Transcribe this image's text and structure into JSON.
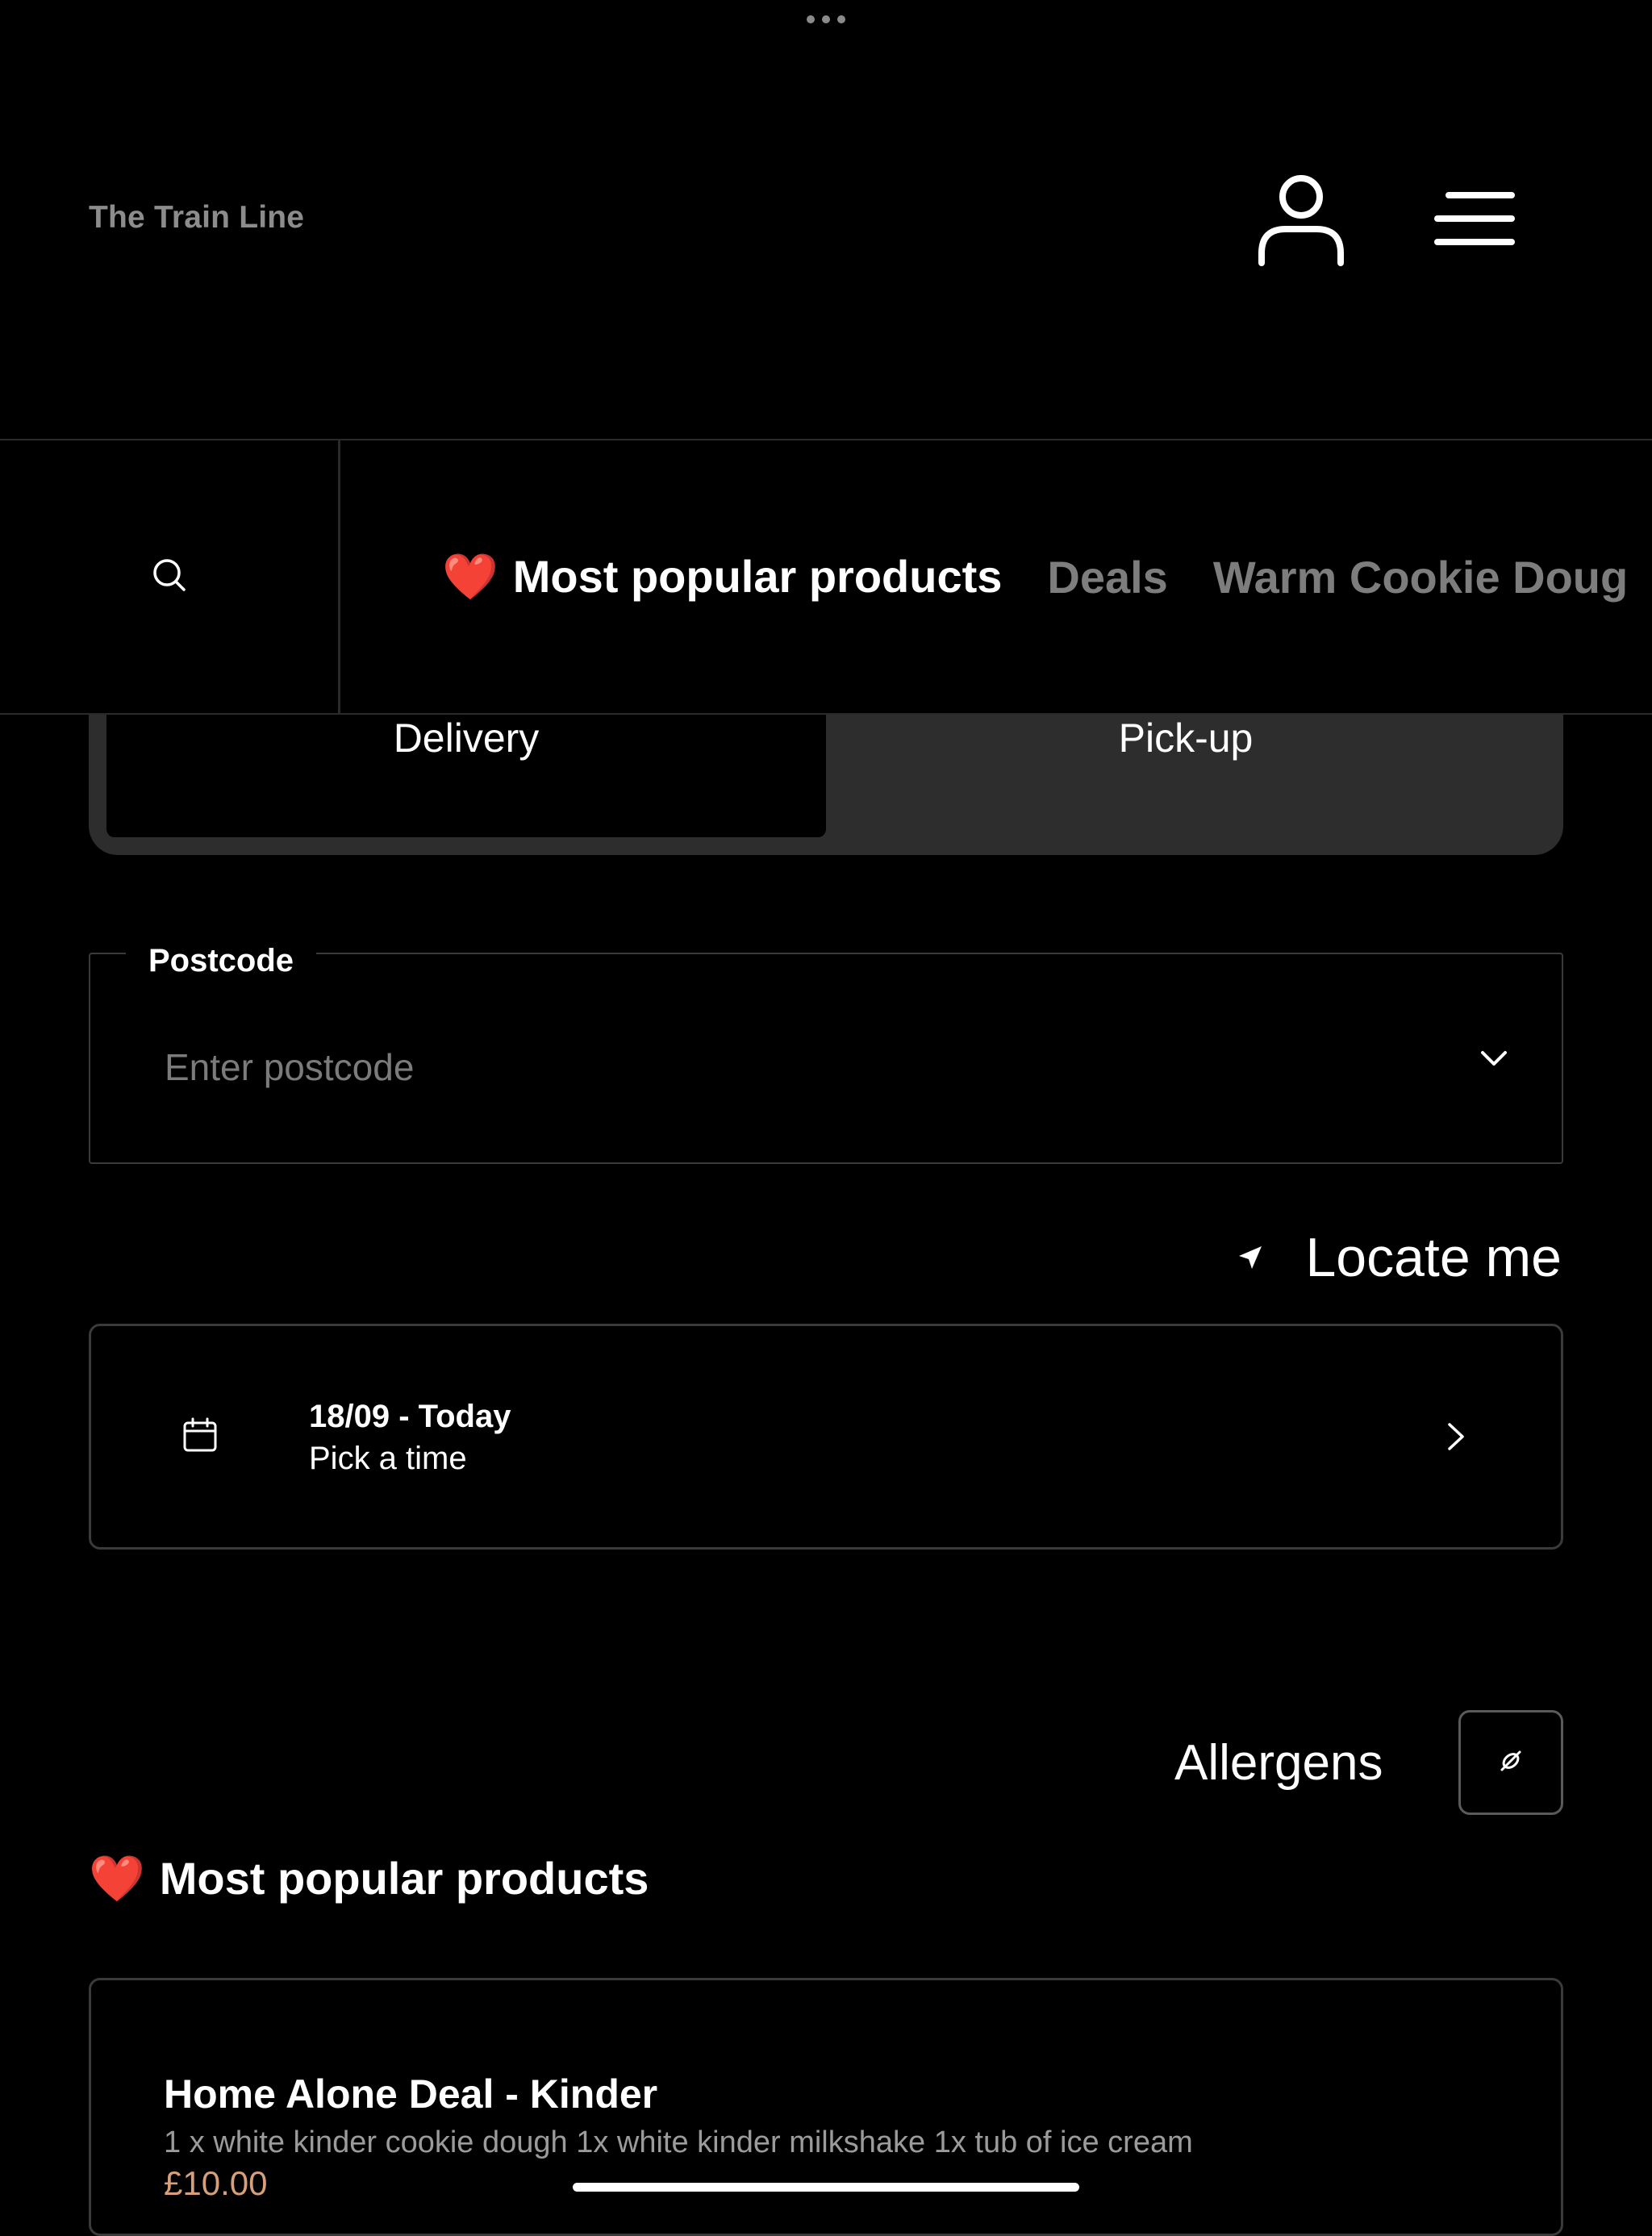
{
  "header": {
    "brand": "The Train Line",
    "icons": {
      "account": "user-icon",
      "menu": "hamburger-menu-icon"
    }
  },
  "category_bar": {
    "search_icon": "search-icon",
    "tabs": [
      {
        "emoji": "❤️",
        "label": "Most popular products",
        "active": true
      },
      {
        "label": "Deals",
        "active": false
      },
      {
        "label": "Warm Cookie Doug",
        "active": false
      }
    ]
  },
  "order_mode": {
    "delivery_label": "Delivery",
    "pickup_label": "Pick-up",
    "selected": "Delivery"
  },
  "postcode": {
    "label": "Postcode",
    "placeholder": "Enter postcode",
    "value": ""
  },
  "locate": {
    "label": "Locate me"
  },
  "time_picker": {
    "date": "18/09 - Today",
    "subtitle": "Pick a time"
  },
  "allergens": {
    "label": "Allergens"
  },
  "section": {
    "emoji": "❤️",
    "title": "Most popular products"
  },
  "products": [
    {
      "name": "Home Alone Deal - Kinder",
      "description": "1 x white kinder cookie dough 1x white kinder milkshake 1x tub of ice cream",
      "price": "£10.00"
    }
  ],
  "colors": {
    "background": "#000000",
    "accent_price": "#d8a07a",
    "heart": "#e3232c",
    "inactive_tab": "#7d7d7d"
  }
}
